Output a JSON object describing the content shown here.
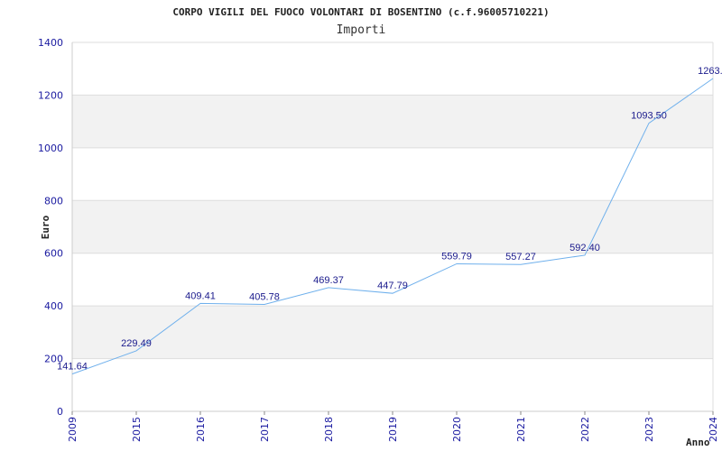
{
  "chart_data": {
    "type": "line",
    "title": "CORPO VIGILI DEL FUOCO VOLONTARI DI BOSENTINO (c.f.96005710221)",
    "subtitle": "Importi",
    "xlabel": "Anno",
    "ylabel": "Euro",
    "ylim": [
      0,
      1400
    ],
    "yticks": [
      "0",
      "200",
      "400",
      "600",
      "800",
      "1000",
      "1200",
      "1400"
    ],
    "categories": [
      "2009",
      "2015",
      "2016",
      "2017",
      "2018",
      "2019",
      "2020",
      "2021",
      "2022",
      "2023",
      "2024"
    ],
    "values": [
      141.64,
      229.49,
      409.41,
      405.78,
      469.37,
      447.79,
      559.79,
      557.27,
      592.4,
      1093.5,
      1263.0
    ],
    "data_labels": [
      "141.64",
      "229.49",
      "409.41",
      "405.78",
      "469.37",
      "447.79",
      "559.79",
      "557.27",
      "592.40",
      "1093.50",
      "1263.0"
    ],
    "grid": true,
    "colors": {
      "line": "#6fb0ec",
      "band": "#f2f2f2",
      "tick_text": "#1a1aa0",
      "label_text": "#1a1a8c"
    }
  }
}
